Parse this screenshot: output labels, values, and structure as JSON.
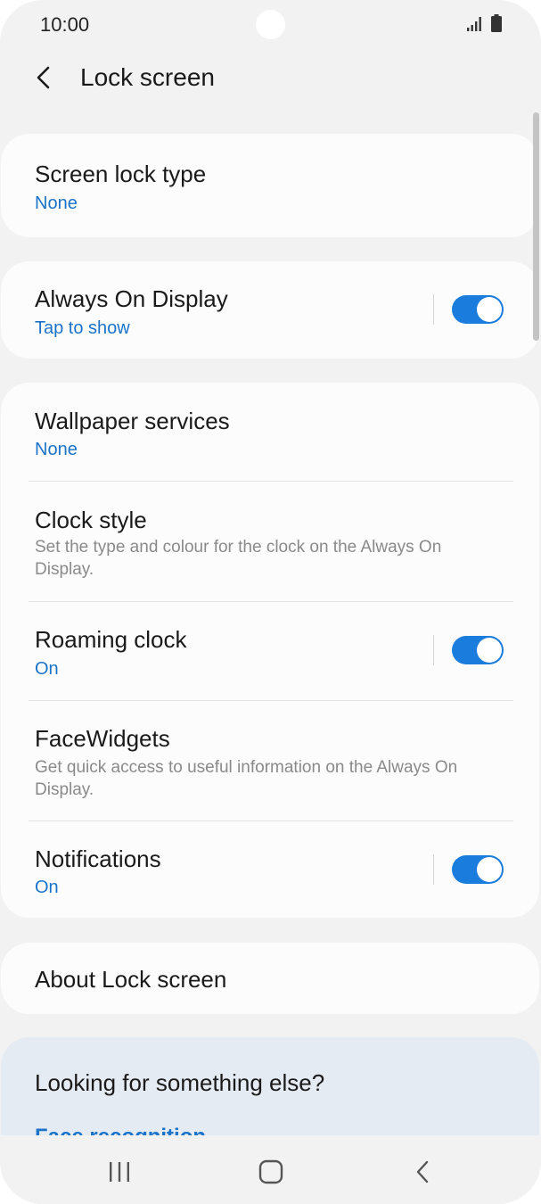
{
  "status_bar": {
    "time": "10:00"
  },
  "header": {
    "title": "Lock screen",
    "back_icon": "back-arrow-icon"
  },
  "sections": {
    "screen_lock": {
      "title": "Screen lock type",
      "value": "None"
    },
    "always_on_display": {
      "title": "Always On Display",
      "value": "Tap to show",
      "toggle_on": true
    },
    "wallpaper_services": {
      "title": "Wallpaper services",
      "value": "None"
    },
    "clock_style": {
      "title": "Clock style",
      "description": "Set the type and colour for the clock on the Always On Display."
    },
    "roaming_clock": {
      "title": "Roaming clock",
      "value": "On",
      "toggle_on": true
    },
    "facewidgets": {
      "title": "FaceWidgets",
      "description": "Get quick access to useful information on the Always On Display."
    },
    "notifications": {
      "title": "Notifications",
      "value": "On",
      "toggle_on": true
    },
    "about": {
      "title": "About Lock screen"
    },
    "help": {
      "title": "Looking for something else?",
      "link": "Face recognition"
    }
  },
  "colors": {
    "accent": "#1a7cdd",
    "link": "#1a73c9",
    "background": "#f2f2f2",
    "card": "#fcfcfc"
  },
  "nav_bar": {
    "icons": [
      "recents-icon",
      "home-icon",
      "back-icon"
    ]
  }
}
